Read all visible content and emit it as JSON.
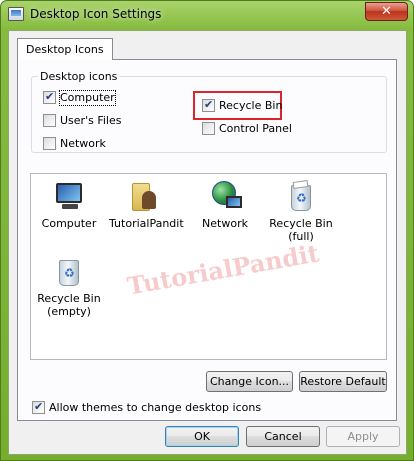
{
  "window": {
    "title": "Desktop Icon Settings",
    "close_glyph": "✕"
  },
  "tabs": [
    {
      "label": "Desktop Icons"
    }
  ],
  "desktop_icons_group": {
    "legend": "Desktop icons",
    "checkboxes": [
      {
        "label": "Computer",
        "checked": true
      },
      {
        "label": "User's Files",
        "checked": false
      },
      {
        "label": "Network",
        "checked": false
      },
      {
        "label": "Recycle Bin",
        "checked": true
      },
      {
        "label": "Control Panel",
        "checked": false
      }
    ]
  },
  "icon_list": {
    "items": [
      {
        "label": "Computer",
        "icon": "computer-icon"
      },
      {
        "label": "TutorialPandit",
        "icon": "user-folder-icon"
      },
      {
        "label": "Network",
        "icon": "network-icon"
      },
      {
        "label": "Recycle Bin\n(full)",
        "icon": "recycle-bin-full-icon"
      },
      {
        "label": "Recycle Bin\n(empty)",
        "icon": "recycle-bin-empty-icon"
      }
    ],
    "watermark": "TutorialPandit"
  },
  "buttons": {
    "change_icon": "Change Icon...",
    "restore_default": "Restore Default",
    "ok": "OK",
    "cancel": "Cancel",
    "apply": "Apply"
  },
  "allow_themes": {
    "label": "Allow themes to change desktop icons",
    "checked": true
  },
  "colors": {
    "title_bar": "#86bb3f",
    "highlight_box": "#d9252b",
    "close_button": "#c94a30"
  }
}
